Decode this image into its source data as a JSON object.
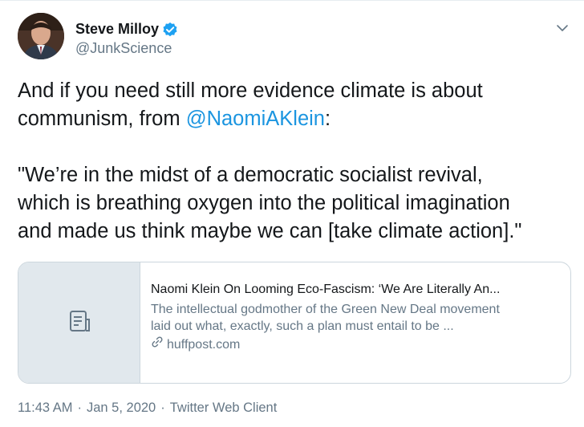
{
  "author": {
    "display_name": "Steve Milloy",
    "handle": "@JunkScience",
    "verified": true
  },
  "tweet": {
    "line1": "And if you need still more evidence climate is about",
    "line2_prefix": "communism, from ",
    "line2_mention": "@NaomiAKlein",
    "line2_suffix": ":",
    "quote_line1": "\"We’re in the midst of a democratic socialist revival,",
    "quote_line2": "which is breathing oxygen into the political imagination",
    "quote_line3": "and made us think maybe we can [take climate action].\""
  },
  "card": {
    "title": "Naomi Klein On Looming Eco-Fascism: ‘We Are Literally An...",
    "description_line1": "The intellectual godmother of the Green New Deal movement",
    "description_line2": "laid out what, exactly, such a plan must entail to be ...",
    "domain": "huffpost.com",
    "thumbnail_icon": "document-icon"
  },
  "meta": {
    "time": "11:43 AM",
    "separator": "·",
    "date": "Jan 5, 2020",
    "source": "Twitter Web Client"
  },
  "colors": {
    "link": "#1b95e0",
    "secondary_text": "#657786",
    "border": "#ccd6dd",
    "verified": "#1da1f2"
  }
}
